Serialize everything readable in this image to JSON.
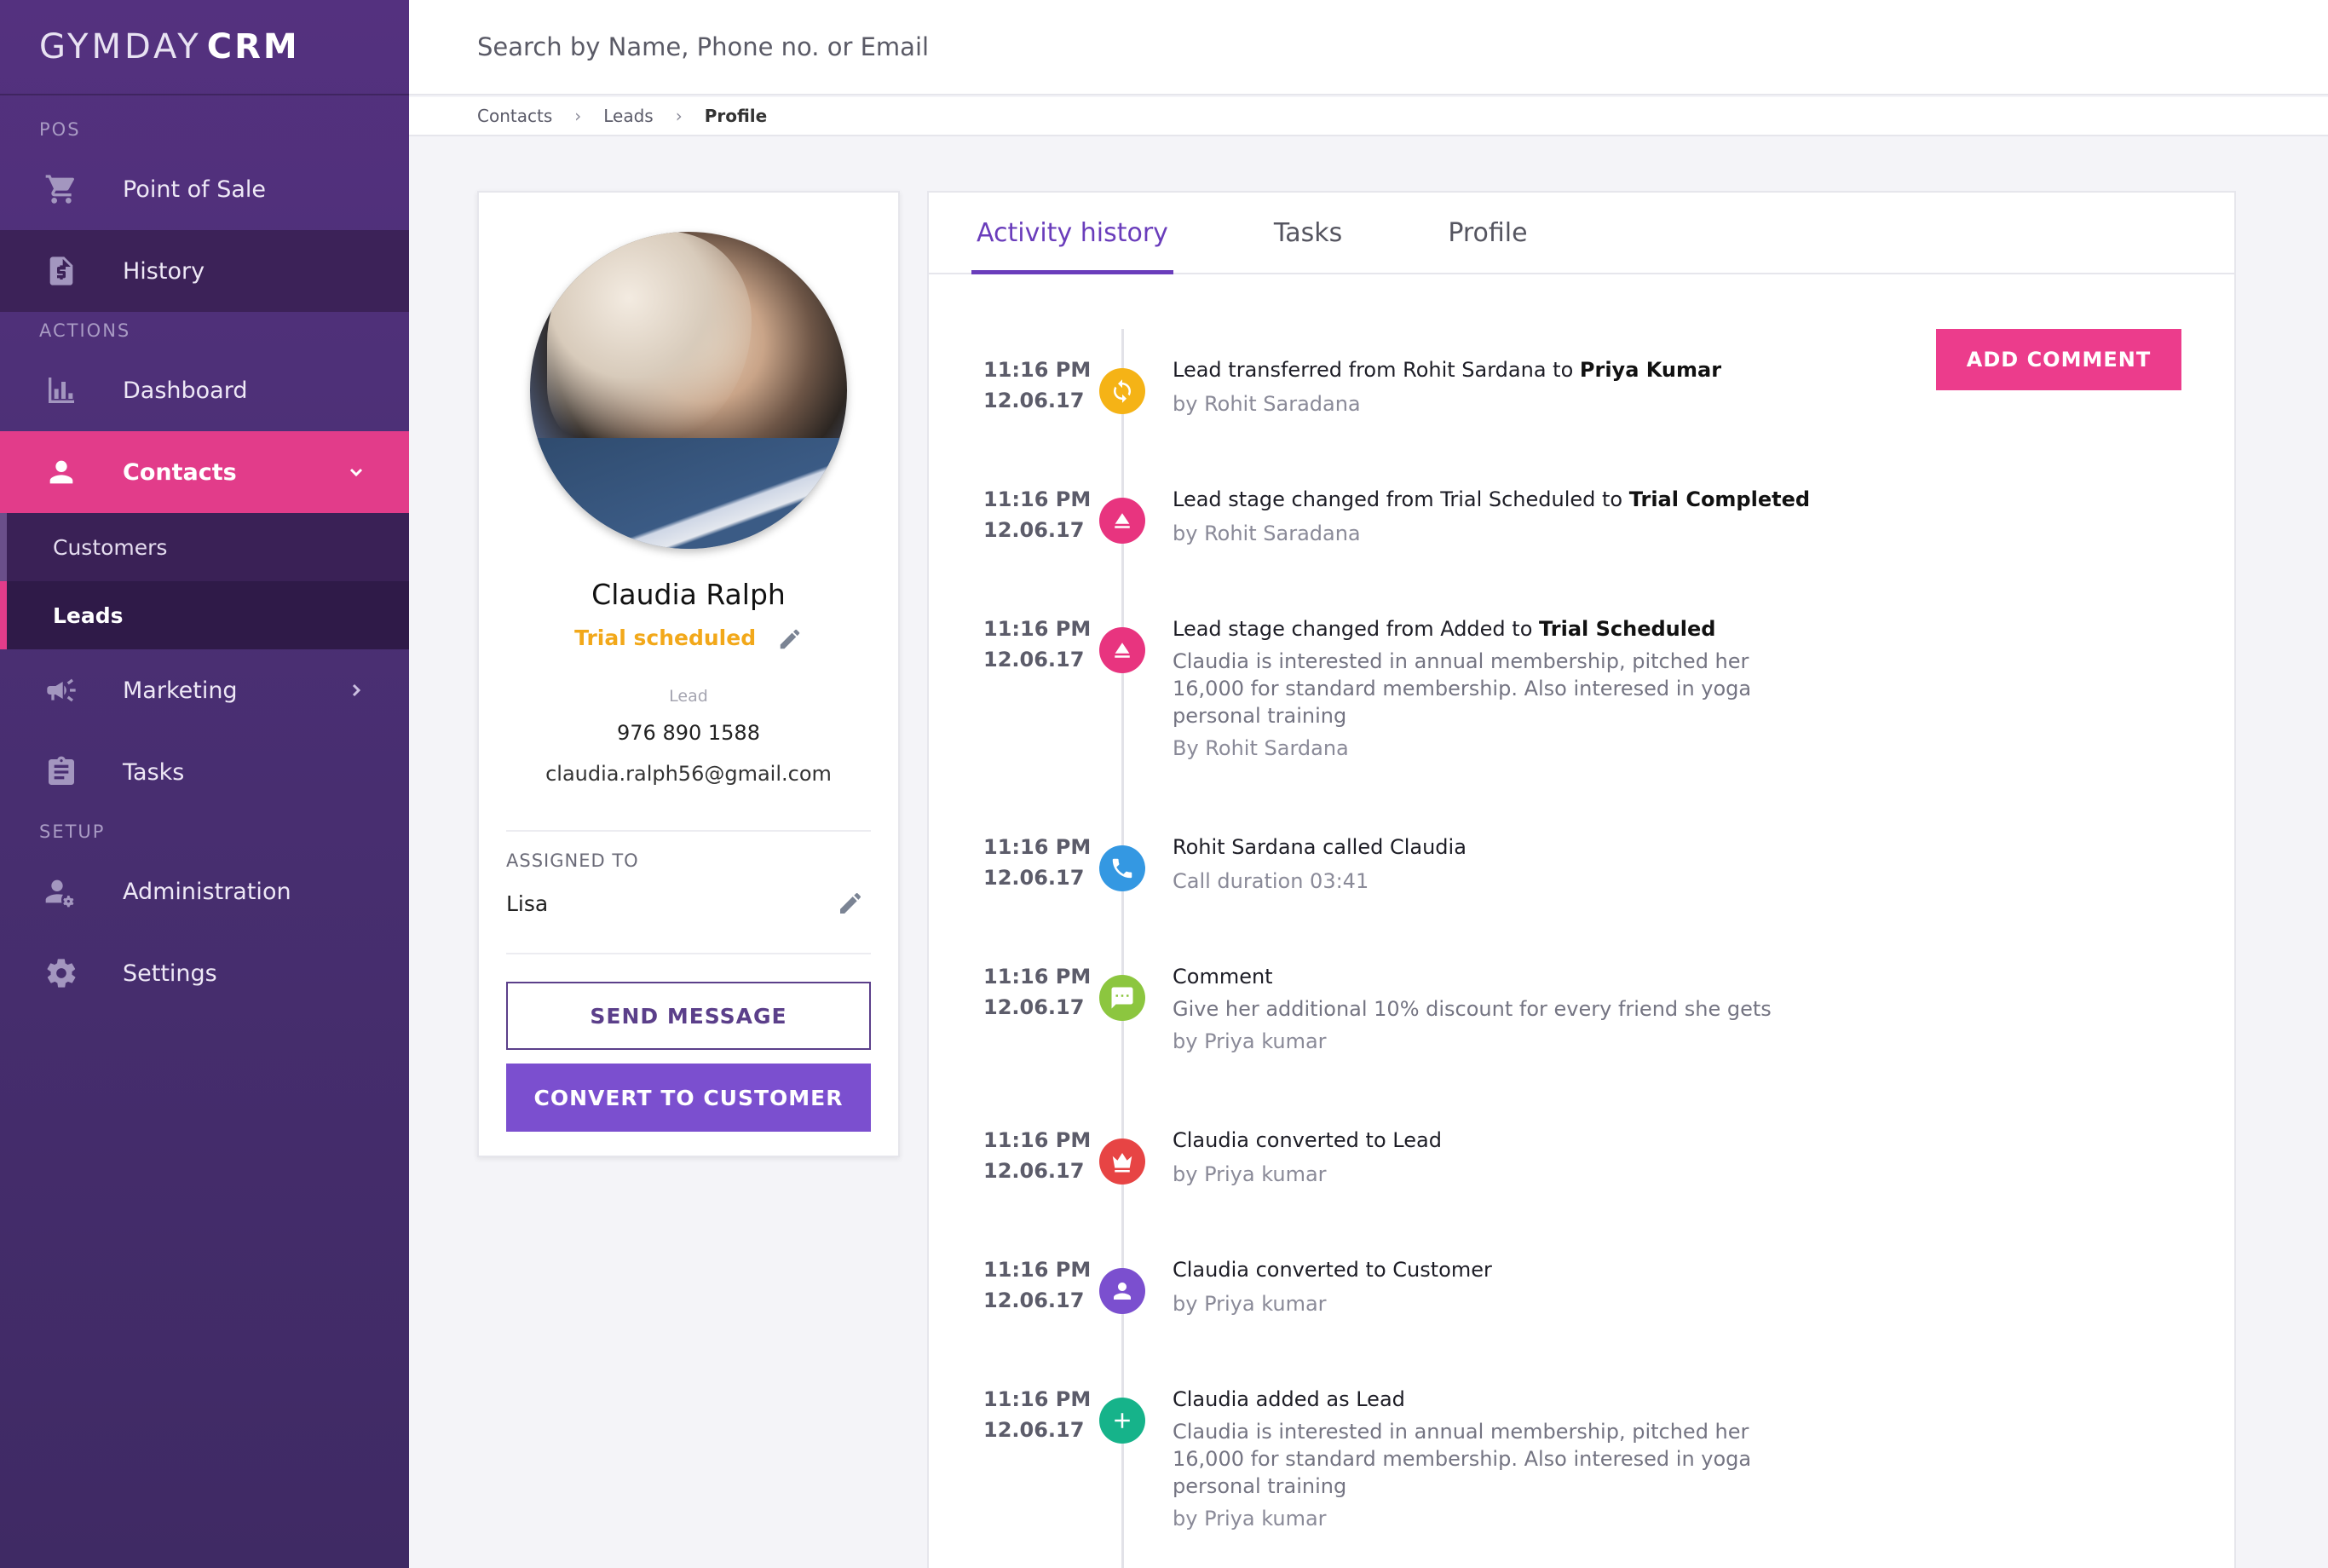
{
  "brand": {
    "light": "GYMDAY",
    "bold": "CRM"
  },
  "search": {
    "placeholder": "Search by Name, Phone no. or Email"
  },
  "breadcrumb": [
    "Contacts",
    "Leads",
    "Profile"
  ],
  "sidebar": {
    "sections": {
      "pos": "POS",
      "actions": "ACTIONS",
      "setup": "SETUP"
    },
    "items": {
      "pos": "Point of Sale",
      "history": "History",
      "dashboard": "Dashboard",
      "contacts": "Contacts",
      "customers": "Customers",
      "leads": "Leads",
      "marketing": "Marketing",
      "tasks": "Tasks",
      "administration": "Administration",
      "settings": "Settings"
    }
  },
  "profile": {
    "name": "Claudia Ralph",
    "stage": "Trial scheduled",
    "type": "Lead",
    "phone": "976 890 1588",
    "email": "claudia.ralph56@gmail.com",
    "assigned_title": "ASSIGNED TO",
    "assigned_name": "Lisa",
    "send_message": "SEND MESSAGE",
    "convert": "CONVERT TO CUSTOMER"
  },
  "tabs": [
    "Activity history",
    "Tasks",
    "Profile"
  ],
  "add_comment": "ADD COMMENT",
  "colors": {
    "accent_pink": "#ec3c8c",
    "accent_purple": "#6a3dbb",
    "stage_yellow": "#f2a81a"
  },
  "events": [
    {
      "time": "11:16 PM",
      "date": "12.06.17",
      "icon": "sync-icon",
      "color": "#f5b316",
      "title_pre": "Lead transferred from Rohit Sardana to ",
      "title_bold": "Priya Kumar",
      "desc": "",
      "by": "by Rohit Saradana"
    },
    {
      "time": "11:16 PM",
      "date": "12.06.17",
      "icon": "eject-icon",
      "color": "#e8347f",
      "title_pre": "Lead stage changed from Trial Scheduled to ",
      "title_bold": "Trial Completed",
      "desc": "",
      "by": "by Rohit Saradana"
    },
    {
      "time": "11:16 PM",
      "date": "12.06.17",
      "icon": "eject-icon",
      "color": "#e8347f",
      "title_pre": "Lead stage changed from Added to ",
      "title_bold": "Trial Scheduled",
      "desc": "Claudia is interested in annual membership, pitched her 16,000 for standard membership. Also interesed in yoga personal training",
      "by": "By Rohit Sardana"
    },
    {
      "time": "11:16 PM",
      "date": "12.06.17",
      "icon": "phone-icon",
      "color": "#3498e2",
      "title_pre": "Rohit Sardana called Claudia",
      "title_bold": "",
      "desc": "",
      "by": "Call duration 03:41"
    },
    {
      "time": "11:16 PM",
      "date": "12.06.17",
      "icon": "comment-icon",
      "color": "#8cc63f",
      "title_pre": "Comment",
      "title_bold": "",
      "desc": "Give her additional 10% discount for every friend she gets",
      "by": "by Priya kumar"
    },
    {
      "time": "11:16 PM",
      "date": "12.06.17",
      "icon": "crown-icon",
      "color": "#e74444",
      "title_pre": "Claudia converted to Lead",
      "title_bold": "",
      "desc": "",
      "by": "by Priya kumar"
    },
    {
      "time": "11:16 PM",
      "date": "12.06.17",
      "icon": "person-icon",
      "color": "#7b4fcf",
      "title_pre": "Claudia converted to Customer",
      "title_bold": "",
      "desc": "",
      "by": "by Priya kumar"
    },
    {
      "time": "11:16 PM",
      "date": "12.06.17",
      "icon": "plus-icon",
      "color": "#16b38a",
      "title_pre": "Claudia added as Lead",
      "title_bold": "",
      "desc": "Claudia is interested in annual membership, pitched her 16,000 for standard membership. Also interesed in yoga personal training",
      "by": "by Priya kumar"
    }
  ]
}
